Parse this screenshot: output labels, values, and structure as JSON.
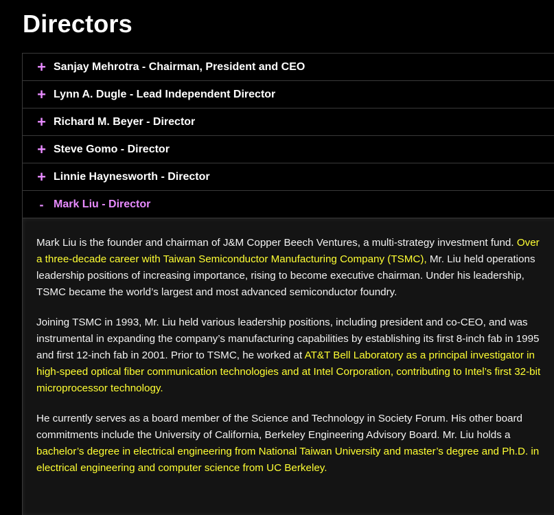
{
  "page": {
    "title": "Directors"
  },
  "accordion": {
    "colors": {
      "accent": "#e88bff",
      "highlight": "#ffff33",
      "border": "#3a3a3a",
      "panel_bg": "#141414"
    },
    "items": [
      {
        "toggle": "+",
        "label": "Sanjay Mehrotra - Chairman, President and CEO",
        "expanded": false
      },
      {
        "toggle": "+",
        "label": "Lynn A. Dugle - Lead Independent Director",
        "expanded": false
      },
      {
        "toggle": "+",
        "label": "Richard M. Beyer - Director",
        "expanded": false
      },
      {
        "toggle": "+",
        "label": "Steve Gomo - Director",
        "expanded": false
      },
      {
        "toggle": "+",
        "label": "Linnie Haynesworth - Director",
        "expanded": false
      },
      {
        "toggle": "-",
        "label": "Mark Liu - Director",
        "expanded": true
      }
    ]
  },
  "bio": {
    "p1": {
      "a": "Mark Liu is the founder and chairman of J&M Copper Beech Ventures, a multi-strategy investment fund. ",
      "hl": "Over a three-decade career with Taiwan Semiconductor Manufacturing Company (TSMC),",
      "b": " Mr. Liu held operations leadership positions of increasing importance, rising to become executive chairman. Under his leadership, TSMC became the world’s largest and most advanced semiconductor foundry."
    },
    "p2": {
      "a": "Joining TSMC in 1993, Mr. Liu held various leadership positions, including president and co-CEO, and was instrumental in expanding the company’s manufacturing capabilities by establishing its first 8-inch fab in 1995 and first 12-inch fab in 2001. Prior to TSMC, he worked at ",
      "hl": "AT&T Bell Laboratory as a principal investigator in high-speed optical fiber communication technologies and at Intel Corporation, contributing to Intel’s first 32-bit microprocessor technology.",
      "b": ""
    },
    "p3": {
      "a": "He currently serves as a board member of the Science and Technology in Society Forum. His other board commitments include the University of California, Berkeley Engineering Advisory Board. Mr. Liu holds a ",
      "hl": "bachelor’s degree in electrical engineering from National Taiwan University and master’s degree and Ph.D. in electrical engineering and computer science from UC Berkeley.",
      "b": ""
    }
  }
}
